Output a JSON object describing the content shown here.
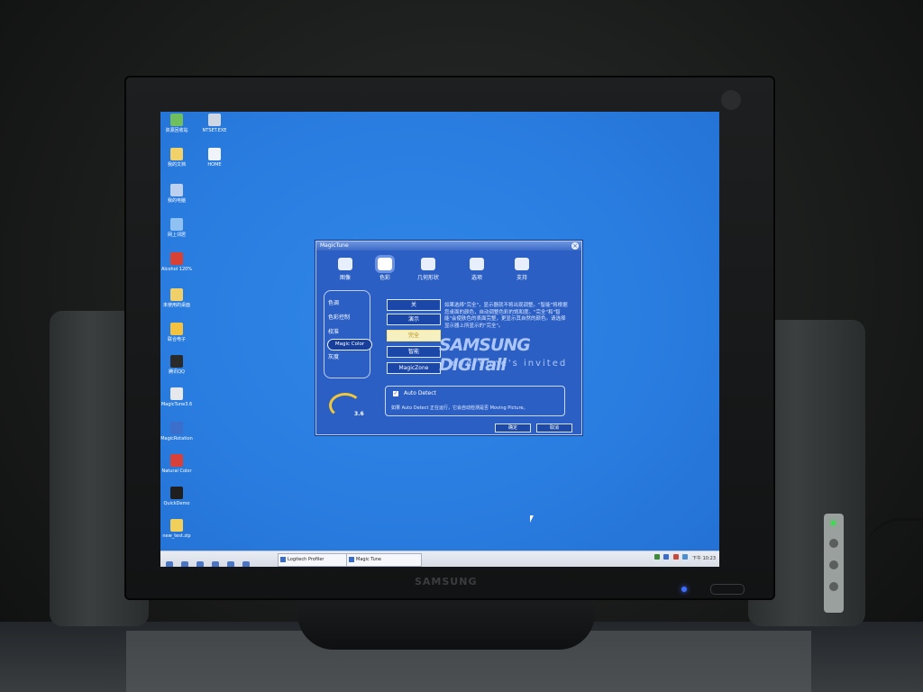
{
  "colors": {
    "desktop": "#2a7de0",
    "window": "#2b5fc4",
    "accent": "#f0c63a"
  },
  "monitor": {
    "brand": "SAMSUNG"
  },
  "desktop": {
    "icons": [
      {
        "label": "资源回收站",
        "name": "recycle-bin-icon",
        "color": "#6fbf5f"
      },
      {
        "label": "NTSET.EXE",
        "name": "ntset-icon",
        "color": "#cfd6e4"
      },
      {
        "label": "我的文档",
        "name": "documents-icon",
        "color": "#f1d16a"
      },
      {
        "label": "HOME",
        "name": "home-icon",
        "color": "#f0f3f8"
      },
      {
        "label": "我的电脑",
        "name": "computer-icon",
        "color": "#bcd1ef"
      },
      {
        "label": "网上邻居",
        "name": "network-icon",
        "color": "#8fc1f2"
      },
      {
        "label": "Alcohol 120%",
        "name": "alcohol-icon",
        "color": "#d84234"
      },
      {
        "label": "未使用的桌面",
        "name": "unused-desktop-icon",
        "color": "#f0d068"
      },
      {
        "label": "联合电子",
        "name": "folder-icon",
        "color": "#f3c241"
      },
      {
        "label": "腾讯QQ",
        "name": "qq-icon",
        "color": "#2a2a2a"
      },
      {
        "label": "MagicTune3.6",
        "name": "magictune-icon",
        "color": "#e6e8ec"
      },
      {
        "label": "MagicRotation",
        "name": "magicrotation-icon",
        "color": "#3c6fcc"
      },
      {
        "label": "Natural Color",
        "name": "naturalcolor-icon",
        "color": "#d8403a"
      },
      {
        "label": "QuickDemo",
        "name": "quickdemo-icon",
        "color": "#1f1f1f"
      },
      {
        "label": "new_test.zip",
        "name": "zip-icon",
        "color": "#f1cf5b"
      }
    ]
  },
  "taskbar": {
    "tasks": [
      {
        "label": "Logitech Profiler"
      },
      {
        "label": "Magic Tune"
      }
    ],
    "clock": "下午 10:23"
  },
  "magictune": {
    "title": "MagicTune",
    "tabs": [
      {
        "label": "图像"
      },
      {
        "label": "色彩"
      },
      {
        "label": "几何形状"
      },
      {
        "label": "选项"
      },
      {
        "label": "支持"
      }
    ],
    "active_tab": "色彩",
    "sidebar": [
      "色调",
      "色彩控制",
      "校准",
      "灰度"
    ],
    "sidebar_selected": "Magic Color",
    "logo_version": "3.6",
    "options": [
      "关",
      "演示",
      "完全",
      "智能",
      "MagicZone"
    ],
    "selected_option": "完全",
    "description": "如果选择\"完全\"，显示器就不将出现调整。\"智能\"将根据您桌面的颜色，自动调整色彩的饱和度。\"完全\"和\"智能\"会使肤色的表面完整，更显示其自然的颜色。请选择显示器上所显示的\"完全\"。",
    "watermark": "SAMSUNG DIGITall",
    "watermark_sub": "everyone's invited",
    "auto_detect_label": "Auto Detect",
    "auto_detect_hint": "如果 Auto Detect 正在运行，它会自动检测是否 Moving Picture。",
    "buttons": {
      "ok": "确定",
      "cancel": "取消"
    }
  }
}
